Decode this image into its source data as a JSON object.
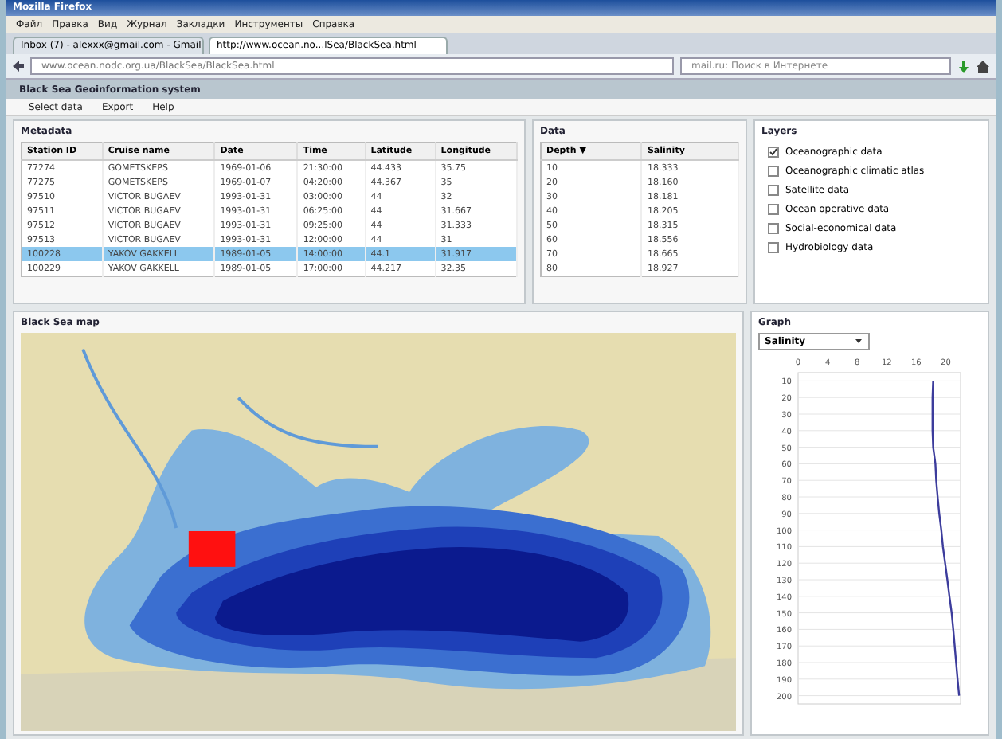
{
  "window": {
    "title": "Mozilla Firefox"
  },
  "menu": [
    "Файл",
    "Правка",
    "Вид",
    "Журнал",
    "Закладки",
    "Инструменты",
    "Справка"
  ],
  "tabs": [
    {
      "label": "Inbox (7) - alexxx@gmail.com - Gmail",
      "selected": false
    },
    {
      "label": "http://www.ocean.no...lSea/BlackSea.html",
      "selected": true
    }
  ],
  "address": {
    "value": "www.ocean.nodc.org.ua/BlackSea/BlackSea.html"
  },
  "search": {
    "placeholder": "mail.ru: Поиск в Интернете"
  },
  "app": {
    "title": "Black Sea Geoinformation system",
    "menu": [
      "Select data",
      "Export",
      "Help"
    ]
  },
  "metadata": {
    "title": "Metadata",
    "columns": [
      "Station ID",
      "Cruise name",
      "Date",
      "Time",
      "Latitude",
      "Longitude"
    ],
    "rows": [
      {
        "cells": [
          "77274",
          "GOMETSKEPS",
          "1969-01-06",
          "21:30:00",
          "44.433",
          "35.75"
        ],
        "selected": false
      },
      {
        "cells": [
          "77275",
          "GOMETSKEPS",
          "1969-01-07",
          "04:20:00",
          "44.367",
          "35"
        ],
        "selected": false
      },
      {
        "cells": [
          "97510",
          "VICTOR BUGAEV",
          "1993-01-31",
          "03:00:00",
          "44",
          "32"
        ],
        "selected": false
      },
      {
        "cells": [
          "97511",
          "VICTOR BUGAEV",
          "1993-01-31",
          "06:25:00",
          "44",
          "31.667"
        ],
        "selected": false
      },
      {
        "cells": [
          "97512",
          "VICTOR BUGAEV",
          "1993-01-31",
          "09:25:00",
          "44",
          "31.333"
        ],
        "selected": false
      },
      {
        "cells": [
          "97513",
          "VICTOR BUGAEV",
          "1993-01-31",
          "12:00:00",
          "44",
          "31"
        ],
        "selected": false
      },
      {
        "cells": [
          "100228",
          "YAKOV GAKKELL",
          "1989-01-05",
          "14:00:00",
          "44.1",
          "31.917"
        ],
        "selected": true
      },
      {
        "cells": [
          "100229",
          "YAKOV GAKKELL",
          "1989-01-05",
          "17:00:00",
          "44.217",
          "32.35"
        ],
        "selected": false
      }
    ]
  },
  "data": {
    "title": "Data",
    "columns": [
      "Depth",
      "Salinity"
    ],
    "sort_mark": "▼",
    "rows": [
      [
        "10",
        "18.333"
      ],
      [
        "20",
        "18.160"
      ],
      [
        "30",
        "18.181"
      ],
      [
        "40",
        "18.205"
      ],
      [
        "50",
        "18.315"
      ],
      [
        "60",
        "18.556"
      ],
      [
        "70",
        "18.665"
      ],
      [
        "80",
        "18.927"
      ]
    ]
  },
  "layers": {
    "title": "Layers",
    "items": [
      {
        "label": "Oceanographic data",
        "checked": true
      },
      {
        "label": "Oceanographic climatic atlas",
        "checked": false
      },
      {
        "label": "Satellite data",
        "checked": false
      },
      {
        "label": "Ocean operative data",
        "checked": false
      },
      {
        "label": "Social-economical data",
        "checked": false
      },
      {
        "label": "Hydrobiology data",
        "checked": false
      }
    ]
  },
  "map": {
    "title": "Black Sea map"
  },
  "graph": {
    "title": "Graph",
    "parameter": "Salinity",
    "chart_data": {
      "type": "line",
      "orientation": "horizontal",
      "categories": [
        "10",
        "20",
        "30",
        "40",
        "50",
        "60",
        "70",
        "80",
        "90",
        "100",
        "110",
        "120",
        "130",
        "140",
        "150",
        "160",
        "170",
        "180",
        "190",
        "200"
      ],
      "grid": true,
      "series": [
        {
          "color": "#3c3c9c",
          "values": [
            18.3,
            18.2,
            18.2,
            18.2,
            18.3,
            18.6,
            18.7,
            18.9,
            19.1,
            19.4,
            19.6,
            19.9,
            20.2,
            20.5,
            20.8,
            21.0,
            21.2,
            21.4,
            21.6,
            21.8
          ]
        }
      ],
      "xlim": [
        0,
        22
      ],
      "xticks": [
        0,
        4,
        8,
        12,
        16,
        20
      ]
    }
  }
}
